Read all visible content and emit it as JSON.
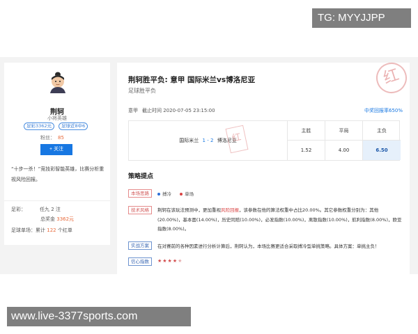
{
  "watermarks": {
    "top": "TG: MYYJJPP",
    "bottom": "www.live-3377sports.com"
  },
  "profile": {
    "name": "荆轲",
    "subtitle": "小将英雄",
    "tags": [
      "足彩3362元",
      "足球近8中6"
    ],
    "fans_label": "粉丝：",
    "fans_count": "85",
    "follow_label": "+ 关注",
    "intro": "“十步一杀！”竞技彩智能英雄，比赛分析重视风险回报。",
    "stats": {
      "label1": "足彩：",
      "value1": "任九 2 注",
      "label2": "总奖金",
      "value2": "3362元",
      "label3": "足球单场：累计",
      "value3": "122",
      "suffix3": "个红单"
    }
  },
  "article": {
    "title": "荆轲胜平负: 意甲 国际米兰vs博洛尼亚",
    "subtitle": "足球胜平负",
    "league": "意甲",
    "deadline": "截止时间 2020-07-05 23:15:00",
    "hit_rate": "中奖回报率650%",
    "stamp_large": "红",
    "stamp_small": "红"
  },
  "odds": {
    "home": "国际米兰",
    "score_home": "1",
    "score_sep": "-",
    "score_away": "2",
    "away": "博洛尼亚",
    "columns": [
      {
        "label": "主胜",
        "value": "1.52"
      },
      {
        "label": "平局",
        "value": "4.00"
      },
      {
        "label": "主负",
        "value": "6.50"
      }
    ]
  },
  "strategy": {
    "heading": "策略提点",
    "badges": {
      "theme": "本场思路",
      "tech": "技术风格",
      "plan": "实战方案",
      "confidence": "信心指数"
    },
    "legend": {
      "upset": "搏冷",
      "single": "单场"
    },
    "analysis_1": "荆轲在该玩法预测中，更加重视",
    "analysis_red": "风险回报",
    "analysis_2": "，该参数在他的算法权重中占比20.00%。其它参数权重分别为：其他(20.00%)，基本面(14.00%)，历史同赔(10.00%)，必发指数(10.00%)，离散指数(10.00%)，航利指数(8.00%)，欧亚指数(8.00%)。",
    "plan_text": "在对赛前的各种因素进行分析计算后，荆轲认为，本场比赛更适合采取搏冷型单挑策略。具体方案：单挑主负！",
    "stars_on": "★★★★",
    "stars_off": "★"
  },
  "colors": {
    "accent": "#1777e2",
    "highlight": "#e86a3b",
    "red": "#d94343"
  }
}
